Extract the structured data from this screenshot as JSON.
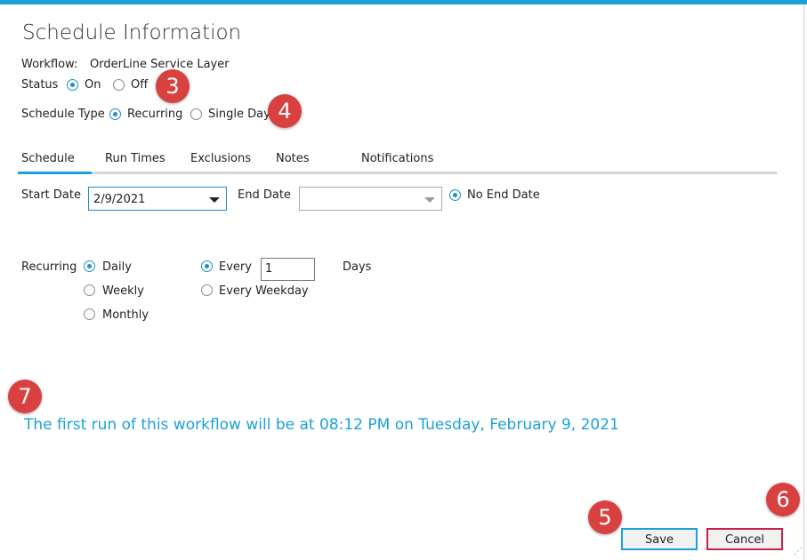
{
  "header": {
    "title": "Schedule Information"
  },
  "workflow": {
    "label": "Workflow:",
    "value": "OrderLine Service Layer"
  },
  "status": {
    "label": "Status",
    "on_label": "On",
    "off_label": "Off",
    "selected": "On"
  },
  "schedule_type": {
    "label": "Schedule Type",
    "recurring_label": "Recurring",
    "single_day_label": "Single Day",
    "selected": "Recurring"
  },
  "tabs": [
    {
      "label": "Schedule",
      "active": true
    },
    {
      "label": "Run Times",
      "active": false
    },
    {
      "label": "Exclusions",
      "active": false
    },
    {
      "label": "Notes",
      "active": false
    },
    {
      "label": "Notifications",
      "active": false
    }
  ],
  "dates": {
    "start_label": "Start Date",
    "start_value": "2/9/2021",
    "end_label": "End Date",
    "end_value": "",
    "no_end_label": "No End Date",
    "no_end_selected": true
  },
  "recurring": {
    "label": "Recurring",
    "options": [
      "Daily",
      "Weekly",
      "Monthly"
    ],
    "selected": "Daily",
    "every_label": "Every",
    "every_value": "1",
    "days_label": "Days",
    "every_weekday_label": "Every Weekday",
    "every_selected": true
  },
  "info_message": "The first run of this workflow will be at 08:12 PM on Tuesday, February 9, 2021",
  "buttons": {
    "save": "Save",
    "cancel": "Cancel"
  },
  "annotations": [
    "3",
    "4",
    "5",
    "6",
    "7"
  ],
  "colors": {
    "accent": "#1ba1d8",
    "annotation": "#d94040",
    "cancel_border": "#c4244c"
  }
}
